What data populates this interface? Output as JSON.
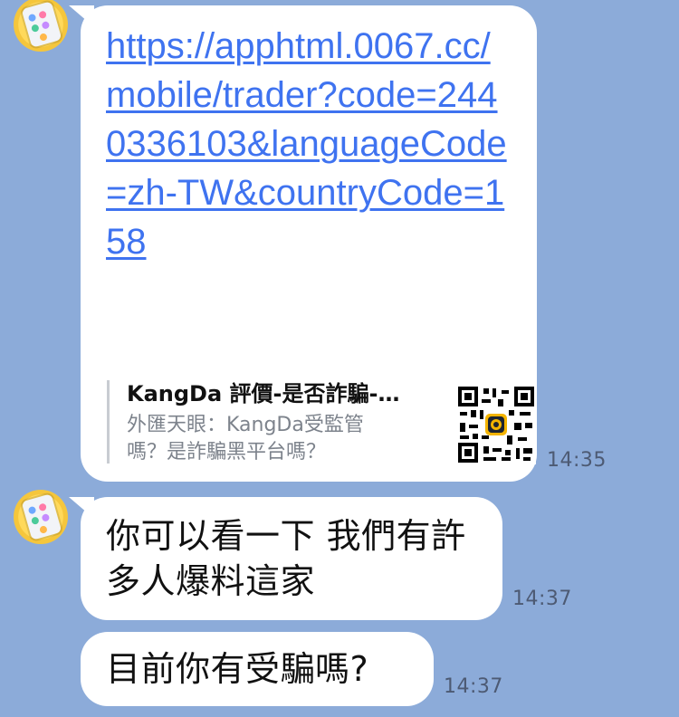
{
  "messages": [
    {
      "link": "https://apphtml.0067.cc/mobile/trader?code=2440336103&languageCode=zh-TW&countryCode=158",
      "preview": {
        "title": "KangDa 評價-是否詐騙-外匯天眼",
        "description": "外匯天眼：KangDa受監管嗎？是詐騙黑平台嗎？"
      },
      "time": "14:35"
    },
    {
      "text": "你可以看一下 我們有許多人爆料這家",
      "time": "14:37"
    },
    {
      "text": "目前你有受騙嗎?",
      "time": "14:37"
    }
  ],
  "colors": {
    "background": "#8cabd9",
    "bubble": "#ffffff",
    "link": "#3f73f0",
    "time": "#4d5a73"
  },
  "icons": {
    "avatar": "phone-app-avatar",
    "thumbnail": "qr-code-icon"
  }
}
